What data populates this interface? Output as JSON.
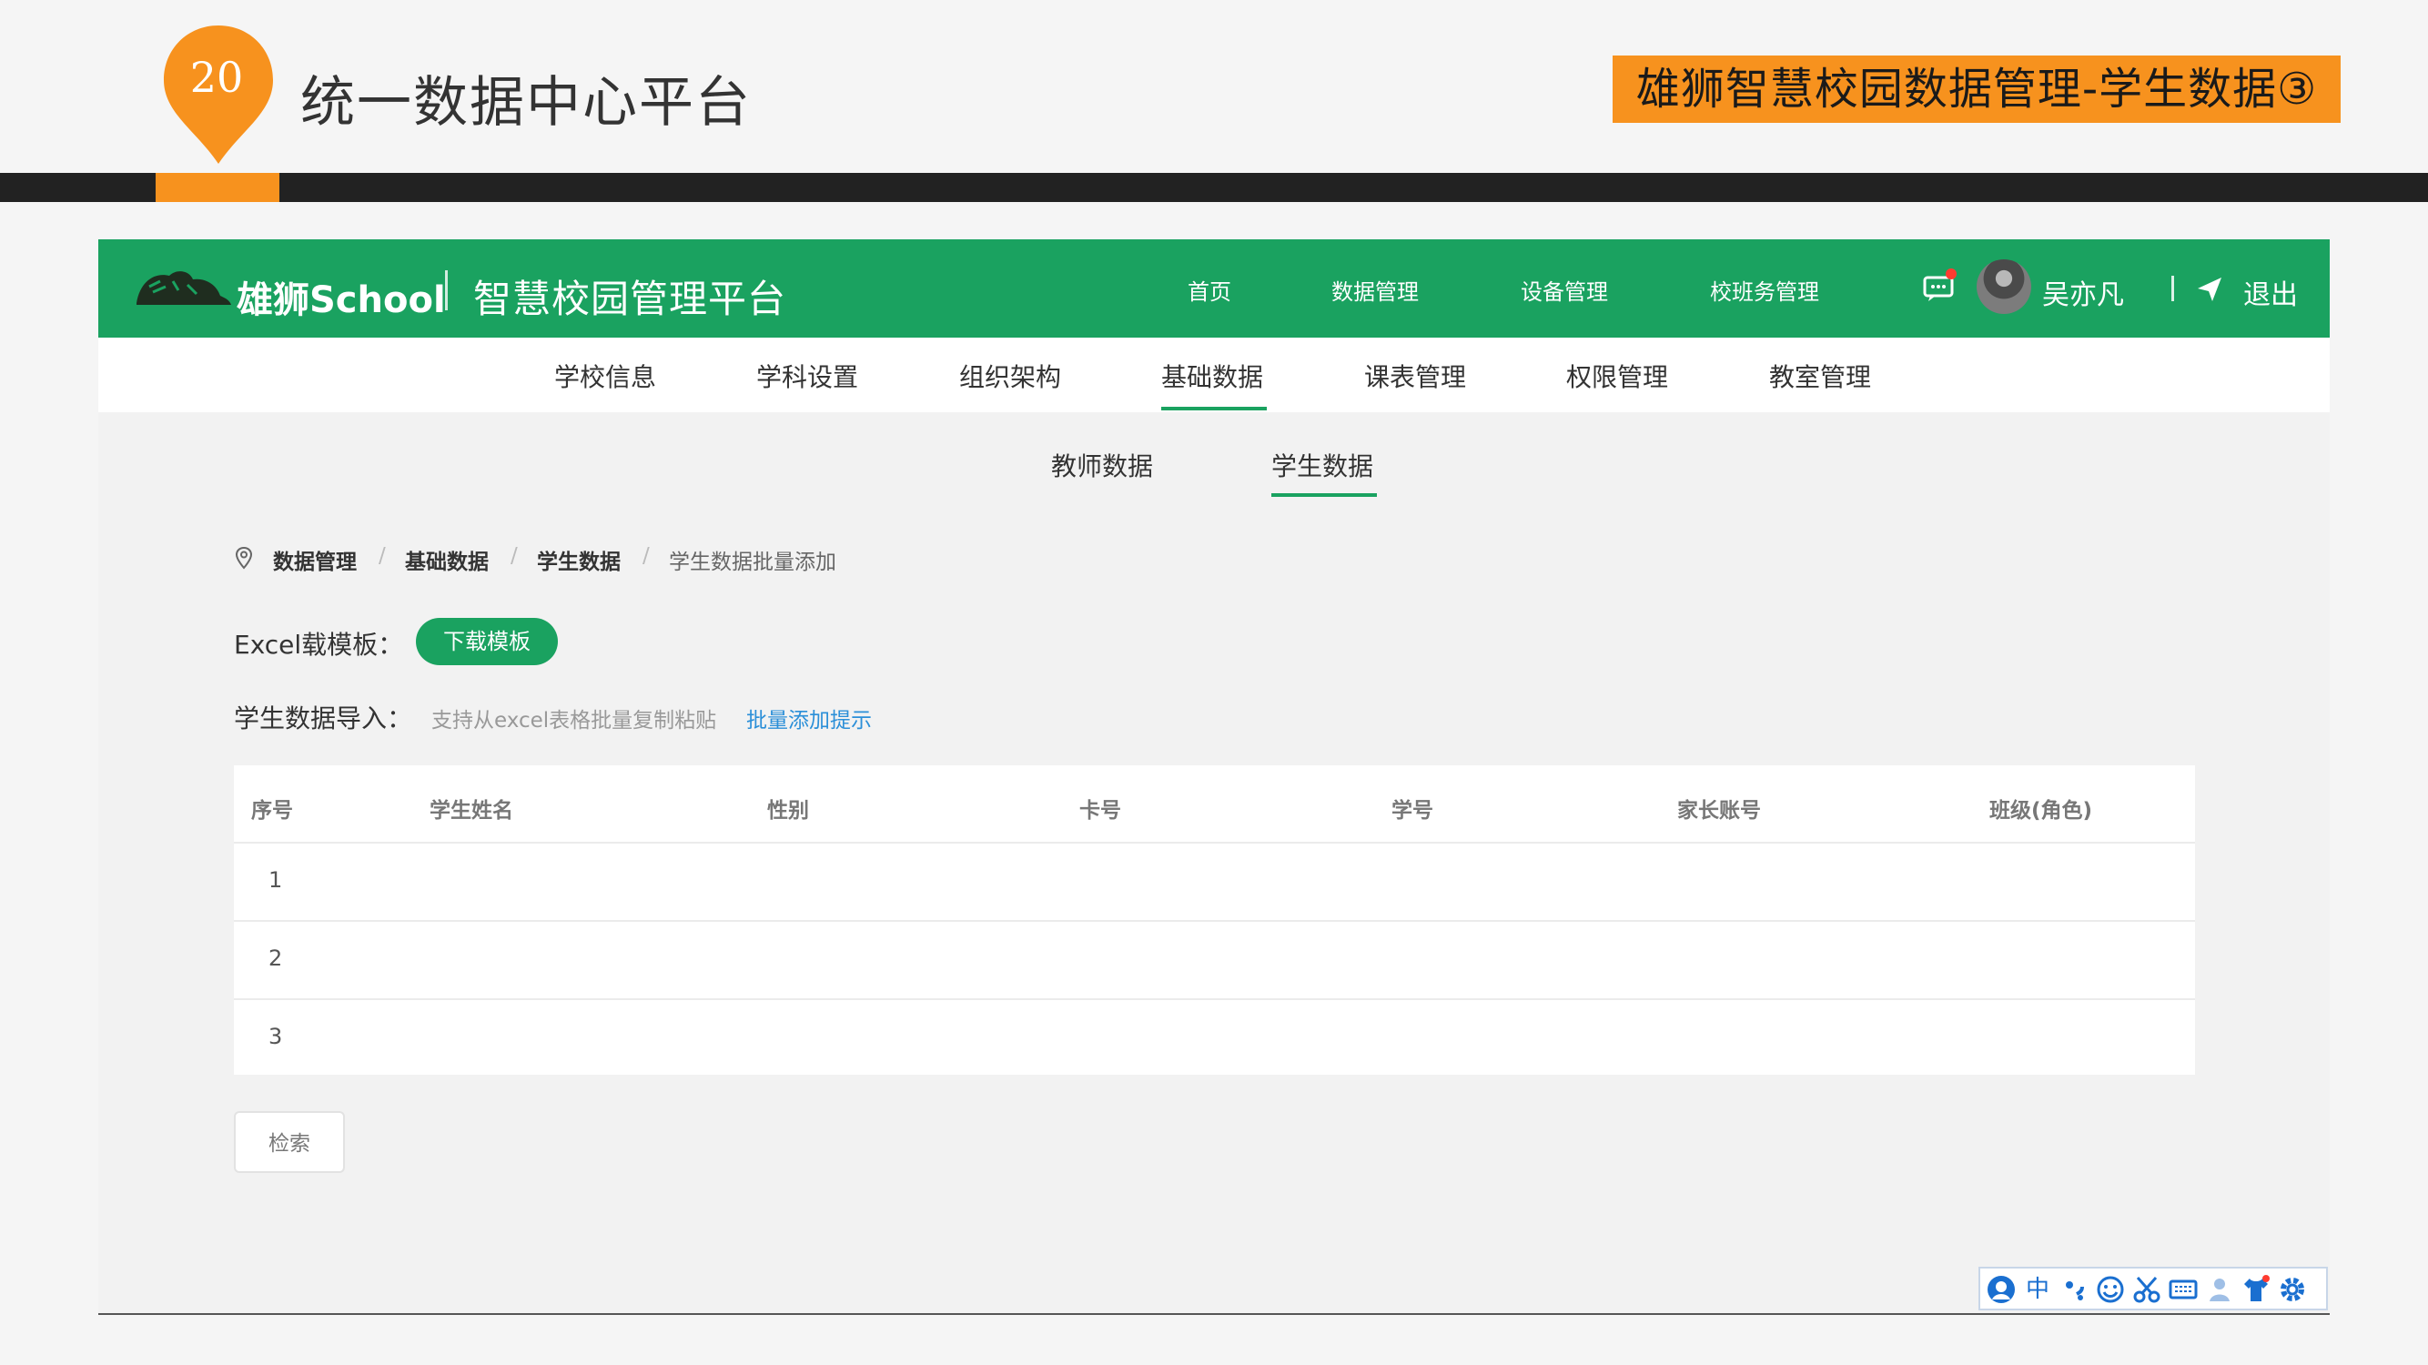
{
  "slide": {
    "number": "20",
    "title": "统一数据中心平台",
    "tag": "雄狮智慧校园数据管理-学生数据③"
  },
  "app": {
    "logo_text": "雄狮School",
    "logo_subtitle": "智慧校园管理平台",
    "nav": [
      "首页",
      "数据管理",
      "设备管理",
      "校班务管理"
    ],
    "user_name": "吴亦凡",
    "logout_label": "退出",
    "subnav": [
      "学校信息",
      "学科设置",
      "组织架构",
      "基础数据",
      "课表管理",
      "权限管理",
      "教室管理"
    ],
    "subnav_active": "基础数据",
    "tabs": [
      "教师数据",
      "学生数据"
    ],
    "tab_active": "学生数据",
    "breadcrumb": [
      "数据管理",
      "基础数据",
      "学生数据",
      "学生数据批量添加"
    ],
    "breadcrumb_separator": "/",
    "template_label": "Excel载模板：",
    "download_button": "下载模板",
    "import_label": "学生数据导入：",
    "import_hint": "支持从excel表格批量复制粘贴",
    "import_hint_link": "批量添加提示",
    "table": {
      "columns": [
        "序号",
        "学生姓名",
        "性别",
        "卡号",
        "学号",
        "家长账号",
        "班级(角色)"
      ],
      "rows": [
        {
          "index": "1"
        },
        {
          "index": "2"
        },
        {
          "index": "3"
        }
      ]
    },
    "search_button": "检索",
    "ime_toolbar": [
      "ime-logo-icon",
      "中",
      "punctuation-icon",
      "emoji-icon",
      "scissors-icon",
      "keyboard-icon",
      "user-icon",
      "shirt-icon",
      "gear-icon"
    ]
  },
  "colors": {
    "brand_green": "#1aa260",
    "accent_orange": "#f7921e",
    "link_blue": "#2b8fd8",
    "dark_bar": "#222222"
  }
}
